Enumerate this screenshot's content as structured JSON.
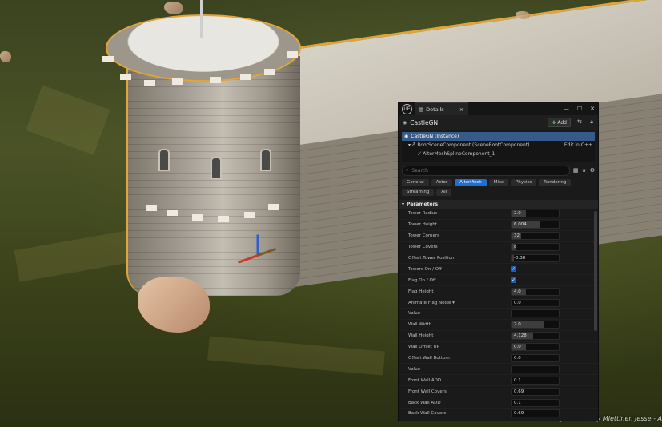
{
  "window": {
    "tab_label": "Details",
    "logo": "UE",
    "controls": [
      "—",
      "☐",
      "✕"
    ]
  },
  "actor": {
    "name": "CastleGN",
    "add_label": "Add"
  },
  "components": [
    {
      "label": "CastleGN (Instance)",
      "selected": true
    },
    {
      "label": "RootSceneComponent (SceneRootComponent)",
      "action": "Edit in C++"
    },
    {
      "label": "AlterMeshSplineComponent_1"
    }
  ],
  "search": {
    "placeholder": "Search"
  },
  "filters": [
    "General",
    "Actor",
    "AlterMesh",
    "Misc",
    "Physics",
    "Rendering",
    "Streaming",
    "All"
  ],
  "active_filter": "AlterMesh",
  "section": {
    "title": "Parameters"
  },
  "parameters": [
    {
      "name": "Tower Radius",
      "value": "2.0",
      "fill": 0.3
    },
    {
      "name": "Tower Height",
      "value": "6.004",
      "fill": 0.6
    },
    {
      "name": "Tower Corners",
      "value": "32",
      "fill": 0.2
    },
    {
      "name": "Tower Covers",
      "value": "8",
      "fill": 0.1
    },
    {
      "name": "Offset Tower Position",
      "value": "-0.38",
      "fill": 0.05
    },
    {
      "name": "Towers On / Off",
      "check": true
    },
    {
      "name": "Flag On / Off",
      "check": true
    },
    {
      "name": "Flag Height",
      "value": "4.0",
      "fill": 0.3
    },
    {
      "name": "Animate Flag Noise ▾",
      "value": "0.0",
      "fill": 0
    },
    {
      "name": "Value",
      "value": "",
      "fill": 0
    },
    {
      "name": "Wall Width",
      "value": "2.0",
      "fill": 0.7
    },
    {
      "name": "Wall Height",
      "value": "4.128",
      "fill": 0.45
    },
    {
      "name": "Wall Offset UP",
      "value": "0.0",
      "fill": 0.3
    },
    {
      "name": "Offset Wall Bottom",
      "value": "0.0",
      "fill": 0
    },
    {
      "name": "Value",
      "value": "",
      "fill": 0
    },
    {
      "name": "Front Wall ADD",
      "value": "0.1",
      "fill": 0
    },
    {
      "name": "Front Wall Covers",
      "value": "0.69",
      "fill": 0
    },
    {
      "name": "Back Wall ADD",
      "value": "0.1",
      "fill": 0
    },
    {
      "name": "Back Wall Covers",
      "value": "0.69",
      "fill": 0
    }
  ],
  "credit": "Castle generator by Miettinen Jesse - A",
  "colors": {
    "accent": "#1f6fd0",
    "selection": "#365a8a",
    "outline": "#e0a53a"
  }
}
